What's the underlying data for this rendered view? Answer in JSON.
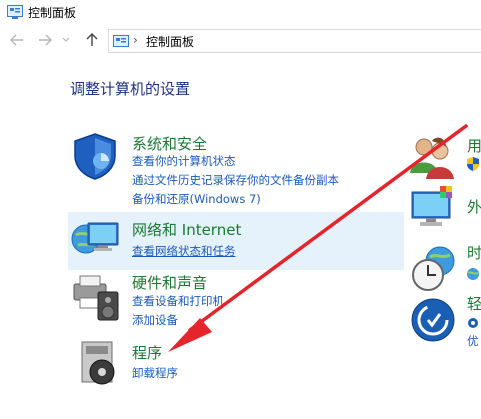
{
  "window": {
    "title": "控制面板"
  },
  "address_bar": {
    "path": "控制面板"
  },
  "heading": "调整计算机的设置",
  "categories": [
    {
      "title": "系统和安全",
      "links": [
        "查看你的计算机状态",
        "通过文件历史记录保存你的文件备份副本",
        "备份和还原(Windows 7)"
      ]
    },
    {
      "title": "网络和 Internet",
      "links": [
        "查看网络状态和任务"
      ]
    },
    {
      "title": "硬件和声音",
      "links": [
        "查看设备和打印机",
        "添加设备"
      ]
    },
    {
      "title": "程序",
      "links": [
        "卸载程序"
      ]
    }
  ],
  "right_categories": [
    {
      "title": "用"
    },
    {
      "title": "外"
    },
    {
      "title": "时"
    },
    {
      "title": "轻",
      "links": [
        "优"
      ]
    }
  ],
  "annotation": {
    "color": "#e6242b"
  }
}
